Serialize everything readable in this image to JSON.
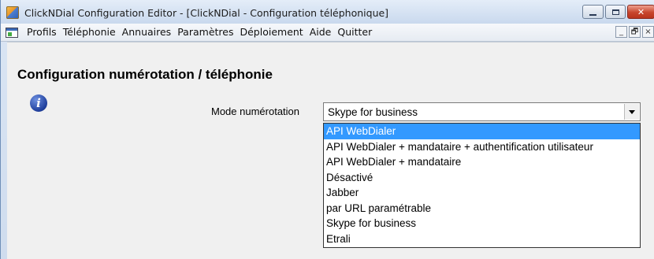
{
  "window": {
    "title": "ClickNDial Configuration Editor - [ClickNDial - Configuration téléphonique]",
    "close_glyph": "✕"
  },
  "menu": {
    "items": [
      "Profils",
      "Téléphonie",
      "Annuaires",
      "Paramètres",
      "Déploiement",
      "Aide",
      "Quitter"
    ],
    "mdi_buttons": [
      "_",
      "🗗",
      "×"
    ]
  },
  "page": {
    "title": "Configuration numérotation / téléphonie",
    "info_glyph": "i"
  },
  "dial_mode": {
    "label": "Mode numérotation",
    "selected_value": "Skype for business",
    "highlighted_index": 0,
    "options": [
      "API WebDialer",
      "API WebDialer + mandataire + authentification utilisateur",
      "API WebDialer + mandataire",
      "Désactivé",
      "Jabber",
      "par URL paramétrable",
      "Skype for business",
      "Etrali"
    ]
  },
  "colors": {
    "selection": "#3399ff",
    "close_button": "#c8452d"
  }
}
